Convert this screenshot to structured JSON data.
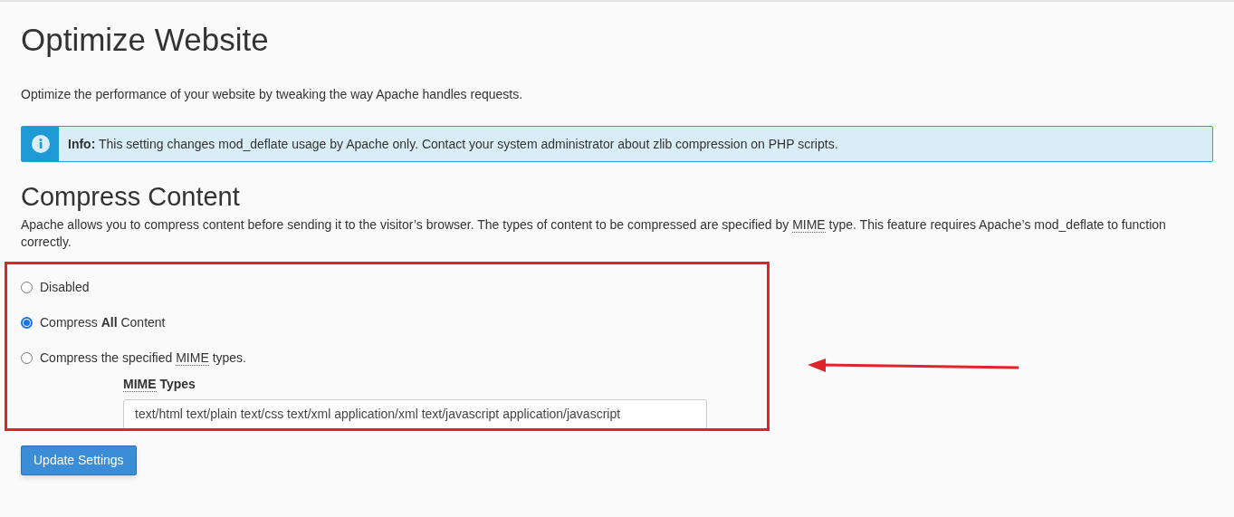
{
  "page_title": "Optimize Website",
  "intro": "Optimize the performance of your website by tweaking the way Apache handles requests.",
  "info": {
    "label": "Info:",
    "text": "This setting changes mod_deflate usage by Apache only. Contact your system administrator about zlib compression on PHP scripts."
  },
  "section": {
    "title": "Compress Content",
    "description": [
      {
        "text": "Apache allows you to compress content before sending it to the visitor’s browser. The types of content to be compressed are specified by "
      },
      {
        "abbr": "MIME"
      },
      {
        "text": " type. This feature requires Apache’s mod_deflate to function correctly."
      }
    ]
  },
  "options": [
    {
      "label": [
        {
          "text": "Disabled"
        }
      ],
      "selected": false
    },
    {
      "label": [
        {
          "text": "Compress **All** Content"
        }
      ],
      "selected": true
    },
    {
      "label": [
        {
          "text": "Compress the specified "
        },
        {
          "abbr": "MIME"
        },
        {
          "text": " types."
        }
      ],
      "selected": false
    }
  ],
  "mime_field": {
    "label": [
      {
        "abbr": "MIME"
      },
      {
        "text": " Types"
      }
    ],
    "value": "text/html text/plain text/css text/xml application/xml text/javascript application/javascript"
  },
  "button": "Update Settings"
}
